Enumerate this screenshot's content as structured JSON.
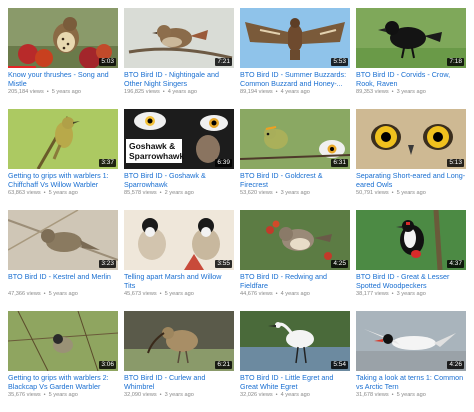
{
  "videos": [
    {
      "title": "Know your thrushes - Song and Mistle",
      "duration": "5:03",
      "views": "205,184 views",
      "age": "5 years ago",
      "watched": 0.25,
      "icon": "thrush-thumbnail"
    },
    {
      "title": "BTO Bird ID - Nightingale and Other Night Singers",
      "duration": "7:21",
      "views": "196,825 views",
      "age": "4 years ago",
      "watched": 0,
      "icon": "nightingale-thumbnail"
    },
    {
      "title": "BTO Bird ID - Summer Buzzards: Common Buzzard and Honey-...",
      "duration": "5:53",
      "views": "89,194 views",
      "age": "4 years ago",
      "watched": 0,
      "icon": "buzzard-thumbnail"
    },
    {
      "title": "BTO Bird ID - Corvids - Crow, Rook, Raven",
      "duration": "7:18",
      "views": "89,353 views",
      "age": "3 years ago",
      "watched": 0,
      "icon": "crow-thumbnail"
    },
    {
      "title": "Getting to grips with warblers 1: Chiffchaff Vs Willow Warbler",
      "duration": "3:37",
      "views": "63,863 views",
      "age": "5 years ago",
      "watched": 0,
      "icon": "warbler-thumbnail"
    },
    {
      "title": "BTO Bird ID - Goshawk & Sparrowhawk",
      "duration": "6:39",
      "views": "85,578 views",
      "age": "2 years ago",
      "watched": 0,
      "icon": "goshawk-thumbnail",
      "overlay": "Goshawk & Sparrowhawk"
    },
    {
      "title": "BTO Bird ID - Goldcrest & Firecrest",
      "duration": "6:31",
      "views": "53,620 views",
      "age": "3 years ago",
      "watched": 0,
      "icon": "goldcrest-thumbnail"
    },
    {
      "title": "Separating Short-eared and Long-eared Owls",
      "duration": "5:13",
      "views": "50,791 views",
      "age": "5 years ago",
      "watched": 0,
      "icon": "owl-eyes-thumbnail"
    },
    {
      "title": "BTO Bird ID - Kestrel and Merlin",
      "duration": "3:23",
      "views": "47,366 views",
      "age": "5 years ago",
      "watched": 0,
      "icon": "kestrel-thumbnail"
    },
    {
      "title": "Telling apart Marsh and Willow Tits",
      "duration": "3:55",
      "views": "45,673 views",
      "age": "5 years ago",
      "watched": 0,
      "icon": "tits-thumbnail"
    },
    {
      "title": "BTO Bird ID - Redwing and Fieldfare",
      "duration": "4:25",
      "views": "44,676 views",
      "age": "4 years ago",
      "watched": 0,
      "icon": "redwing-thumbnail"
    },
    {
      "title": "BTO Bird ID - Great & Lesser Spotted Woodpeckers",
      "duration": "4:37",
      "views": "38,177 views",
      "age": "3 years ago",
      "watched": 0,
      "icon": "woodpecker-thumbnail"
    },
    {
      "title": "Getting to grips with warblers 2: Blackcap Vs Garden Warbler",
      "duration": "3:06",
      "views": "35,676 views",
      "age": "5 years ago",
      "watched": 0,
      "icon": "blackcap-thumbnail"
    },
    {
      "title": "BTO Bird ID - Curlew and Whimbrel",
      "duration": "6:21",
      "views": "32,090 views",
      "age": "3 years ago",
      "watched": 0,
      "icon": "curlew-thumbnail"
    },
    {
      "title": "BTO Bird ID - Little Egret and Great White Egret",
      "duration": "5:54",
      "views": "32,026 views",
      "age": "4 years ago",
      "watched": 0,
      "icon": "egret-thumbnail"
    },
    {
      "title": "Taking a look at terns 1: Common vs Arctic Tern",
      "duration": "4:26",
      "views": "31,678 views",
      "age": "5 years ago",
      "watched": 0,
      "icon": "tern-thumbnail"
    }
  ],
  "colors": {
    "title_link": "#1a6fd1",
    "meta": "#888888",
    "progress": "#e22626",
    "duration_bg": "#000000"
  },
  "separator": "•"
}
